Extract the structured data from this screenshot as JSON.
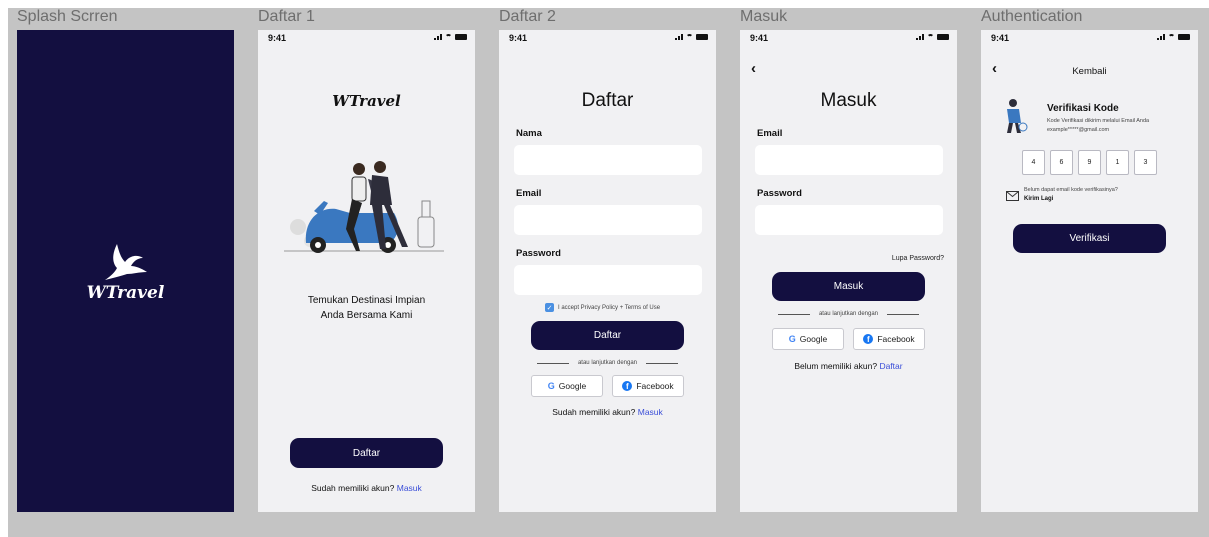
{
  "frames": {
    "splash": {
      "label": "Splash Scrren",
      "logo": "WTravel"
    },
    "daftar1": {
      "label": "Daftar 1",
      "time": "9:41",
      "logo": "WTravel",
      "tagline_line1": "Temukan Destinasi Impian",
      "tagline_line2": "Anda Bersama Kami",
      "register_button": "Daftar",
      "have_account_text": "Sudah memiliki akun?",
      "login_link": "Masuk"
    },
    "daftar2": {
      "label": "Daftar 2",
      "time": "9:41",
      "title": "Daftar",
      "name_label": "Nama",
      "email_label": "Email",
      "password_label": "Password",
      "name_value": "",
      "email_value": "",
      "password_value": "",
      "privacy_text": "I accept Privacy Policy + Terms of Use",
      "register_button": "Daftar",
      "or_continue": "atau lanjutkan dengan",
      "google_button": "Google",
      "facebook_button": "Facebook",
      "have_account_text": "Sudah memiliki akun?",
      "login_link": "Masuk"
    },
    "masuk": {
      "label": "Masuk",
      "time": "9:41",
      "back_icon": "chevron-left-icon",
      "title": "Masuk",
      "email_label": "Email",
      "password_label": "Password",
      "email_value": "",
      "password_value": "",
      "forgot_password": "Lupa Password?",
      "login_button": "Masuk",
      "or_continue": "atau lanjutkan dengan",
      "google_button": "Google",
      "facebook_button": "Facebook",
      "no_account_text": "Belum memiliki akun?",
      "register_link": "Daftar"
    },
    "auth": {
      "label": "Authentication",
      "time": "9:41",
      "back_label": "Kembali",
      "heading": "Verifikasi Kode",
      "subtext_line1": "Kode Verifikasi dikirim melalui Email Anda",
      "subtext_line2": "example*****@gmail.com",
      "otp_digits": [
        "4",
        "6",
        "9",
        "1",
        "3"
      ],
      "resend_question": "Belum dapat email kode verifikasinya?",
      "resend_link": "Kirim Lagi",
      "verify_button": "Verifikasi"
    }
  },
  "colors": {
    "primary": "#130f40",
    "canvas": "#c4c4c4",
    "frame_bg": "#f1f1f3",
    "link": "#3b4fd8"
  }
}
